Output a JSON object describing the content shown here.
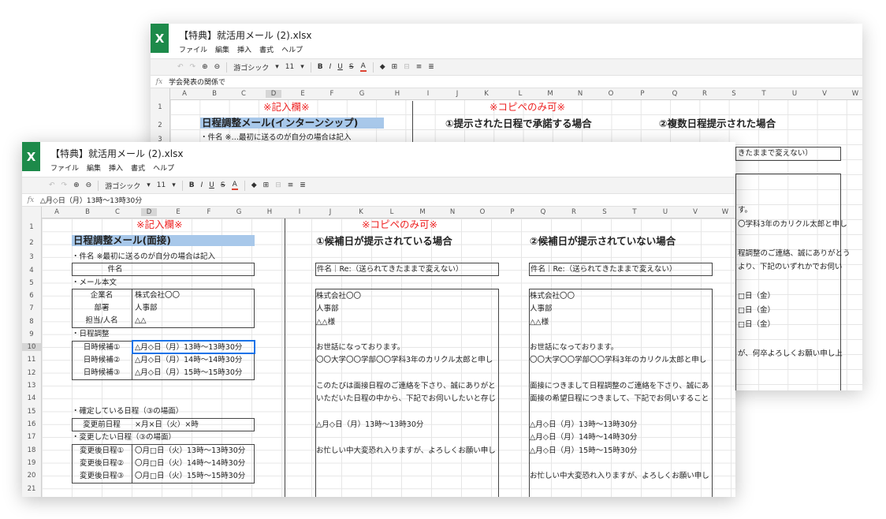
{
  "back": {
    "logo": "X",
    "title": "【特典】就活用メール (2).xlsx",
    "menu": [
      "ファイル",
      "編集",
      "挿入",
      "書式",
      "ヘルプ"
    ],
    "toolbar": {
      "undo": "↶",
      "redo": "↷",
      "font": "游ゴシック",
      "size": "11"
    },
    "fx": "fx",
    "formula": "学会発表の関係で",
    "columns": [
      "A",
      "B",
      "C",
      "D",
      "E",
      "F",
      "G",
      "H",
      "I",
      "J",
      "K",
      "L",
      "M",
      "N",
      "O",
      "P",
      "Q",
      "R",
      "S",
      "T",
      "U",
      "V",
      "W"
    ],
    "rows": [
      "1",
      "2",
      "3"
    ],
    "cells": {
      "label_kinyu": "※記入欄※",
      "label_copy": "※コピペのみ可※",
      "h_intern": "日程調整メール(インターンシップ)",
      "h_accept": "①提示された日程で承諾する場合",
      "h_multi": "②複数日程提示された場合",
      "r3": "・件名 ※…最初に送るのが自分の場合は記入",
      "subject_tail": "きたままで変えない）",
      "lines": [
        "す。",
        "〇学科3年のカリクル太郎と申し",
        "",
        "程調整のご連絡、誠にありがとう",
        "より、下記のいずれかでお伺い",
        "",
        "□日（金）",
        "□日（金）",
        "□日（金）",
        "",
        "が、何卒よろしくお願い申し上"
      ]
    }
  },
  "front": {
    "logo": "X",
    "title": "【特典】就活用メール (2).xlsx",
    "menu": [
      "ファイル",
      "編集",
      "挿入",
      "書式",
      "ヘルプ"
    ],
    "toolbar": {
      "undo": "↶",
      "redo": "↷",
      "font": "游ゴシック",
      "size": "11"
    },
    "fx": "fx",
    "formula": "△月◇日（月）13時〜13時30分",
    "columns": [
      "A",
      "B",
      "C",
      "D",
      "E",
      "F",
      "G",
      "H",
      "I",
      "J",
      "K",
      "L",
      "M",
      "N",
      "O",
      "P",
      "Q",
      "R",
      "S",
      "T",
      "U",
      "V",
      "W"
    ],
    "rows": [
      "1",
      "2",
      "3",
      "4",
      "5",
      "6",
      "7",
      "8",
      "9",
      "10",
      "11",
      "12",
      "13",
      "14",
      "15",
      "16",
      "17",
      "18",
      "19",
      "20",
      "21"
    ],
    "cells": {
      "label_kinyu": "※記入欄※",
      "label_copy": "※コピペのみ可※",
      "h_interview": "日程調整メール(面接)",
      "h_candidates": "①候補日が提示されている場合",
      "h_nocandidates": "②候補日が提示されていない場合",
      "subject_note": "・件名 ※最初に送るのが自分の場合は記入",
      "subject_label": "件名",
      "body_label": "・メール本文",
      "company_label": "企業名",
      "company_value": "株式会社〇〇",
      "dept_label": "部署",
      "dept_value": "人事部",
      "person_label": "担当/人名",
      "person_value": "△△",
      "schedule_label": "・日程調整",
      "cand1_label": "日時候補①",
      "cand1_value": "△月◇日（月）13時〜13時30分",
      "cand2_label": "日時候補②",
      "cand2_value": "△月◇日（月）14時〜14時30分",
      "cand3_label": "日時候補③",
      "cand3_value": "△月◇日（月）15時〜15時30分",
      "confirmed_label": "・確定している日程（③の場面）",
      "before_label": "変更前日程",
      "before_value": "×月×日（火）×時",
      "change_label": "・変更したい日程（③の場面）",
      "after1_label": "変更後日程①",
      "after1_value": "〇月□日（火）13時〜13時30分",
      "after2_label": "変更後日程②",
      "after2_value": "〇月□日（火）14時〜14時30分",
      "after3_label": "変更後日程③",
      "after3_value": "〇月□日（火）15時〜15時30分",
      "subj_re_1": "件名｜Re:（送られてきたままで変えない）",
      "subj_re_2": "件名｜Re:（送られてきたままで変えない）",
      "mail1": [
        "株式会社〇〇",
        "人事部",
        "△△様",
        "",
        "お世話になっております。",
        "〇〇大学〇〇学部〇〇学科3年のカリクル太郎と申し",
        "",
        "このたびは面接日程のご連絡を下さり、誠にありがと",
        "いただいた日程の中から、下記でお伺いしたいと存じ",
        "",
        "△月◇日（月）13時〜13時30分",
        "",
        "お忙しい中大変恐れ入りますが、よろしくお願い申し"
      ],
      "mail2": [
        "株式会社〇〇",
        "人事部",
        "△△様",
        "",
        "お世話になっております。",
        "〇〇大学〇〇学部〇〇学科3年のカリクル太郎と申し",
        "",
        "面接につきまして日程調整のご連絡を下さり、誠にあ",
        "面接の希望日程につきまして、下記でお伺いすること",
        "",
        "△月◇日（月）13時〜13時30分",
        "△月◇日（月）14時〜14時30分",
        "△月◇日（月）15時〜15時30分",
        "",
        "お忙しい中大変恐れ入りますが、よろしくお願い申し"
      ],
      "partial": [
        "〇学科3年のカリクル太郎と申し",
        "",
        "程調整のご連絡、誠にありがとう",
        "より、下記のいずれかでお伺い",
        "",
        "□日（金）",
        "□日（金）",
        "□日（金）",
        "",
        "が、何卒よろしくお願い申し上"
      ]
    }
  }
}
